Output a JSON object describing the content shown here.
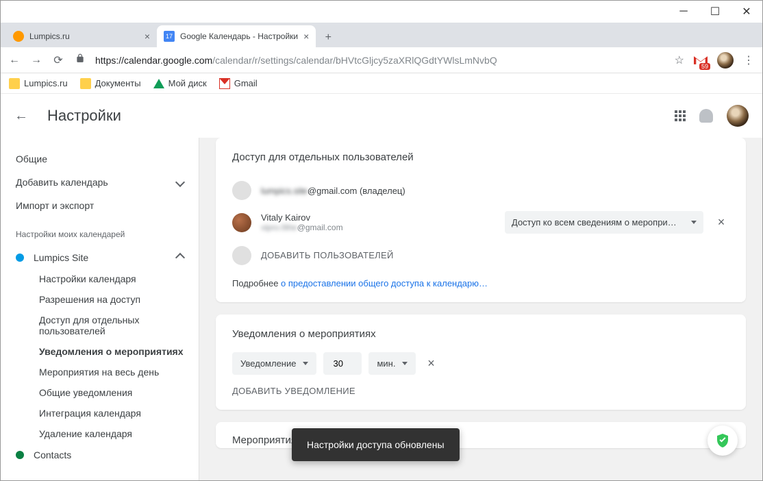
{
  "window": {
    "tabs": [
      {
        "title": "Lumpics.ru",
        "favicon_day": ""
      },
      {
        "title": "Google Календарь - Настройки",
        "favicon_day": "17"
      }
    ]
  },
  "addressbar": {
    "host": "https://calendar.google.com",
    "path": "/calendar/r/settings/calendar/bHVtcGljcy5zaXRlQGdtYWlsLmNvbQ",
    "gmail_badge": "59"
  },
  "bookmarks": [
    {
      "label": "Lumpics.ru"
    },
    {
      "label": "Документы"
    },
    {
      "label": "Мой диск"
    },
    {
      "label": "Gmail"
    }
  ],
  "header": {
    "title": "Настройки"
  },
  "sidebar": {
    "items": [
      {
        "label": "Общие"
      },
      {
        "label": "Добавить календарь"
      },
      {
        "label": "Импорт и экспорт"
      }
    ],
    "section_label": "Настройки моих календарей",
    "calendars": [
      {
        "name": "Lumpics Site",
        "color": "#039be5",
        "subs": [
          "Настройки календаря",
          "Разрешения на доступ",
          "Доступ для отдельных пользователей",
          "Уведомления о мероприятиях",
          "Мероприятия на весь день",
          "Общие уведомления",
          "Интеграция календаря",
          "Удаление календаря"
        ],
        "active_index": 3
      },
      {
        "name": "Contacts",
        "color": "#0b8043"
      }
    ]
  },
  "access_card": {
    "title": "Доступ для отдельных пользователей",
    "owner_email_visible": "@gmail.com",
    "owner_suffix": " (владелец)",
    "user_name": "Vitaly Kairov",
    "user_email_visible": "@gmail.com",
    "permission": "Доступ ко всем сведениям о меропри…",
    "add_label": "ДОБАВИТЬ ПОЛЬЗОВАТЕЛЕЙ",
    "more_prefix": "Подробнее ",
    "more_link": "о предоставлении общего доступа к календарю…"
  },
  "notif_card": {
    "title": "Уведомления о мероприятиях",
    "type": "Уведомление",
    "value": "30",
    "unit": "мин.",
    "add_label": "ДОБАВИТЬ УВЕДОМЛЕНИЕ"
  },
  "allday_card": {
    "title": "Мероприятия на весь день"
  },
  "toast": "Настройки доступа обновлены"
}
